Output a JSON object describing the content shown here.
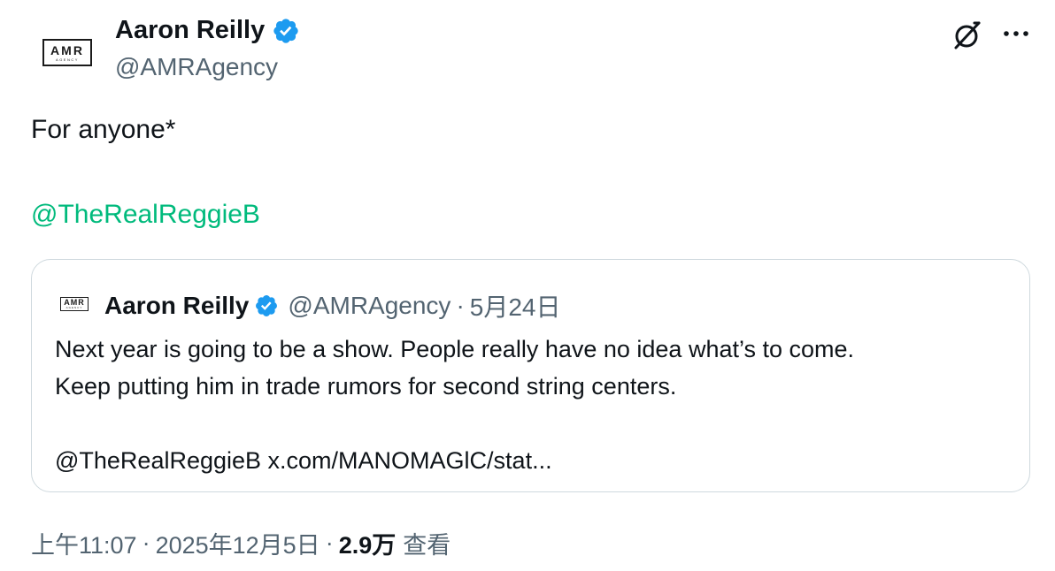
{
  "author": {
    "name": "Aaron Reilly",
    "handle": "@AMRAgency",
    "logo_text": "AMR",
    "logo_subtext": "AGENCY"
  },
  "tweet": {
    "text": "For anyone*",
    "mention": "@TheRealReggieB"
  },
  "quote": {
    "name": "Aaron Reilly",
    "handle": "@AMRAgency",
    "separator": "·",
    "date": "5月24日",
    "line1": "Next year is going to be a show.  People really have no idea what’s to come.",
    "line2": "Keep putting him in trade rumors for second string centers.",
    "line3": "",
    "line4": "@TheRealReggieB x.com/MANOMAGlC/stat..."
  },
  "footer": {
    "time": "上午11:07",
    "sep1": "·",
    "date": "2025年12月5日",
    "sep2": "·",
    "views_count": "2.9万",
    "views_label": "查看"
  },
  "icons": {
    "verified": "verified-badge-icon",
    "grok": "grok-icon",
    "more": "more-icon"
  },
  "colors": {
    "accent": "#1d9bf0",
    "mention": "#00ba7c",
    "secondary_text": "#536471",
    "border": "#cfd9de"
  }
}
